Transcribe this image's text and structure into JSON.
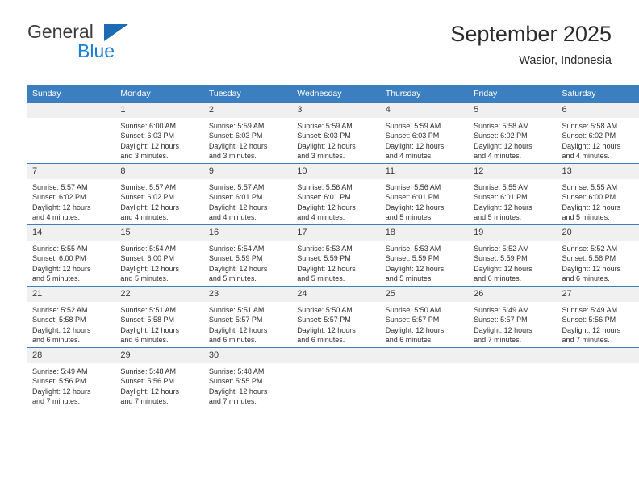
{
  "brand": {
    "name_part1": "General",
    "name_part2": "Blue",
    "accent_color": "#1b7fd4",
    "triangle_color": "#1b6cb5"
  },
  "header": {
    "title": "September 2025",
    "subtitle": "Wasior, Indonesia"
  },
  "theme": {
    "header_row_bg": "#3c7fc0",
    "daynum_bg": "#f0f0f0",
    "grid_line": "#3c7fc0",
    "text": "#2f2f2f"
  },
  "weekday_headers": [
    "Sunday",
    "Monday",
    "Tuesday",
    "Wednesday",
    "Thursday",
    "Friday",
    "Saturday"
  ],
  "weeks": [
    [
      {
        "day": "",
        "blank": true,
        "sunrise": "",
        "sunset": "",
        "daylight_line1": "",
        "daylight_line2": ""
      },
      {
        "day": "1",
        "sunrise": "Sunrise: 6:00 AM",
        "sunset": "Sunset: 6:03 PM",
        "daylight_line1": "Daylight: 12 hours",
        "daylight_line2": "and 3 minutes."
      },
      {
        "day": "2",
        "sunrise": "Sunrise: 5:59 AM",
        "sunset": "Sunset: 6:03 PM",
        "daylight_line1": "Daylight: 12 hours",
        "daylight_line2": "and 3 minutes."
      },
      {
        "day": "3",
        "sunrise": "Sunrise: 5:59 AM",
        "sunset": "Sunset: 6:03 PM",
        "daylight_line1": "Daylight: 12 hours",
        "daylight_line2": "and 3 minutes."
      },
      {
        "day": "4",
        "sunrise": "Sunrise: 5:59 AM",
        "sunset": "Sunset: 6:03 PM",
        "daylight_line1": "Daylight: 12 hours",
        "daylight_line2": "and 4 minutes."
      },
      {
        "day": "5",
        "sunrise": "Sunrise: 5:58 AM",
        "sunset": "Sunset: 6:02 PM",
        "daylight_line1": "Daylight: 12 hours",
        "daylight_line2": "and 4 minutes."
      },
      {
        "day": "6",
        "sunrise": "Sunrise: 5:58 AM",
        "sunset": "Sunset: 6:02 PM",
        "daylight_line1": "Daylight: 12 hours",
        "daylight_line2": "and 4 minutes."
      }
    ],
    [
      {
        "day": "7",
        "sunrise": "Sunrise: 5:57 AM",
        "sunset": "Sunset: 6:02 PM",
        "daylight_line1": "Daylight: 12 hours",
        "daylight_line2": "and 4 minutes."
      },
      {
        "day": "8",
        "sunrise": "Sunrise: 5:57 AM",
        "sunset": "Sunset: 6:02 PM",
        "daylight_line1": "Daylight: 12 hours",
        "daylight_line2": "and 4 minutes."
      },
      {
        "day": "9",
        "sunrise": "Sunrise: 5:57 AM",
        "sunset": "Sunset: 6:01 PM",
        "daylight_line1": "Daylight: 12 hours",
        "daylight_line2": "and 4 minutes."
      },
      {
        "day": "10",
        "sunrise": "Sunrise: 5:56 AM",
        "sunset": "Sunset: 6:01 PM",
        "daylight_line1": "Daylight: 12 hours",
        "daylight_line2": "and 4 minutes."
      },
      {
        "day": "11",
        "sunrise": "Sunrise: 5:56 AM",
        "sunset": "Sunset: 6:01 PM",
        "daylight_line1": "Daylight: 12 hours",
        "daylight_line2": "and 5 minutes."
      },
      {
        "day": "12",
        "sunrise": "Sunrise: 5:55 AM",
        "sunset": "Sunset: 6:01 PM",
        "daylight_line1": "Daylight: 12 hours",
        "daylight_line2": "and 5 minutes."
      },
      {
        "day": "13",
        "sunrise": "Sunrise: 5:55 AM",
        "sunset": "Sunset: 6:00 PM",
        "daylight_line1": "Daylight: 12 hours",
        "daylight_line2": "and 5 minutes."
      }
    ],
    [
      {
        "day": "14",
        "sunrise": "Sunrise: 5:55 AM",
        "sunset": "Sunset: 6:00 PM",
        "daylight_line1": "Daylight: 12 hours",
        "daylight_line2": "and 5 minutes."
      },
      {
        "day": "15",
        "sunrise": "Sunrise: 5:54 AM",
        "sunset": "Sunset: 6:00 PM",
        "daylight_line1": "Daylight: 12 hours",
        "daylight_line2": "and 5 minutes."
      },
      {
        "day": "16",
        "sunrise": "Sunrise: 5:54 AM",
        "sunset": "Sunset: 5:59 PM",
        "daylight_line1": "Daylight: 12 hours",
        "daylight_line2": "and 5 minutes."
      },
      {
        "day": "17",
        "sunrise": "Sunrise: 5:53 AM",
        "sunset": "Sunset: 5:59 PM",
        "daylight_line1": "Daylight: 12 hours",
        "daylight_line2": "and 5 minutes."
      },
      {
        "day": "18",
        "sunrise": "Sunrise: 5:53 AM",
        "sunset": "Sunset: 5:59 PM",
        "daylight_line1": "Daylight: 12 hours",
        "daylight_line2": "and 5 minutes."
      },
      {
        "day": "19",
        "sunrise": "Sunrise: 5:52 AM",
        "sunset": "Sunset: 5:59 PM",
        "daylight_line1": "Daylight: 12 hours",
        "daylight_line2": "and 6 minutes."
      },
      {
        "day": "20",
        "sunrise": "Sunrise: 5:52 AM",
        "sunset": "Sunset: 5:58 PM",
        "daylight_line1": "Daylight: 12 hours",
        "daylight_line2": "and 6 minutes."
      }
    ],
    [
      {
        "day": "21",
        "sunrise": "Sunrise: 5:52 AM",
        "sunset": "Sunset: 5:58 PM",
        "daylight_line1": "Daylight: 12 hours",
        "daylight_line2": "and 6 minutes."
      },
      {
        "day": "22",
        "sunrise": "Sunrise: 5:51 AM",
        "sunset": "Sunset: 5:58 PM",
        "daylight_line1": "Daylight: 12 hours",
        "daylight_line2": "and 6 minutes."
      },
      {
        "day": "23",
        "sunrise": "Sunrise: 5:51 AM",
        "sunset": "Sunset: 5:57 PM",
        "daylight_line1": "Daylight: 12 hours",
        "daylight_line2": "and 6 minutes."
      },
      {
        "day": "24",
        "sunrise": "Sunrise: 5:50 AM",
        "sunset": "Sunset: 5:57 PM",
        "daylight_line1": "Daylight: 12 hours",
        "daylight_line2": "and 6 minutes."
      },
      {
        "day": "25",
        "sunrise": "Sunrise: 5:50 AM",
        "sunset": "Sunset: 5:57 PM",
        "daylight_line1": "Daylight: 12 hours",
        "daylight_line2": "and 6 minutes."
      },
      {
        "day": "26",
        "sunrise": "Sunrise: 5:49 AM",
        "sunset": "Sunset: 5:57 PM",
        "daylight_line1": "Daylight: 12 hours",
        "daylight_line2": "and 7 minutes."
      },
      {
        "day": "27",
        "sunrise": "Sunrise: 5:49 AM",
        "sunset": "Sunset: 5:56 PM",
        "daylight_line1": "Daylight: 12 hours",
        "daylight_line2": "and 7 minutes."
      }
    ],
    [
      {
        "day": "28",
        "sunrise": "Sunrise: 5:49 AM",
        "sunset": "Sunset: 5:56 PM",
        "daylight_line1": "Daylight: 12 hours",
        "daylight_line2": "and 7 minutes."
      },
      {
        "day": "29",
        "sunrise": "Sunrise: 5:48 AM",
        "sunset": "Sunset: 5:56 PM",
        "daylight_line1": "Daylight: 12 hours",
        "daylight_line2": "and 7 minutes."
      },
      {
        "day": "30",
        "sunrise": "Sunrise: 5:48 AM",
        "sunset": "Sunset: 5:55 PM",
        "daylight_line1": "Daylight: 12 hours",
        "daylight_line2": "and 7 minutes."
      },
      {
        "day": "",
        "blank": true,
        "sunrise": "",
        "sunset": "",
        "daylight_line1": "",
        "daylight_line2": ""
      },
      {
        "day": "",
        "blank": true,
        "sunrise": "",
        "sunset": "",
        "daylight_line1": "",
        "daylight_line2": ""
      },
      {
        "day": "",
        "blank": true,
        "sunrise": "",
        "sunset": "",
        "daylight_line1": "",
        "daylight_line2": ""
      },
      {
        "day": "",
        "blank": true,
        "sunrise": "",
        "sunset": "",
        "daylight_line1": "",
        "daylight_line2": ""
      }
    ]
  ]
}
